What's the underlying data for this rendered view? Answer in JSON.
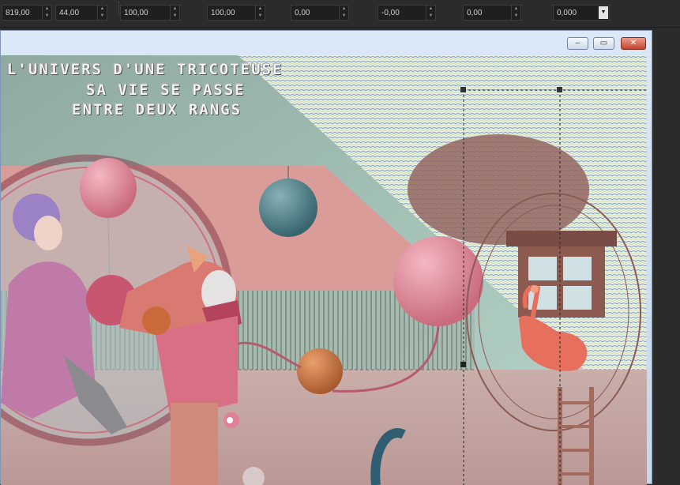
{
  "toolbar": {
    "fields": [
      {
        "value": "819,00"
      },
      {
        "value": "44,00"
      },
      {
        "value": "100,00"
      },
      {
        "value": "100,00"
      },
      {
        "value": "0,00"
      },
      {
        "value": "-0,00"
      },
      {
        "value": "0,00"
      },
      {
        "value": "0,000"
      }
    ],
    "dropdown_icon": "chevron-down-icon"
  },
  "window": {
    "controls": {
      "minimize": "–",
      "maximize": "▭",
      "close": "✕"
    }
  },
  "artwork": {
    "title_lines": [
      "L'UNIVERS D'UNE TRICOTEUSE",
      "SA VIE SE PASSE",
      "ENTRE DEUX RANGS"
    ]
  },
  "colors": {
    "app_bg": "#2b2b2b",
    "window_frame": "#c5d7ee",
    "close_button": "#c4422d",
    "canvas_teal": "#9fb9ad",
    "pink_balloon": "#dd8a98",
    "teal_ball": "#4d7f88"
  }
}
